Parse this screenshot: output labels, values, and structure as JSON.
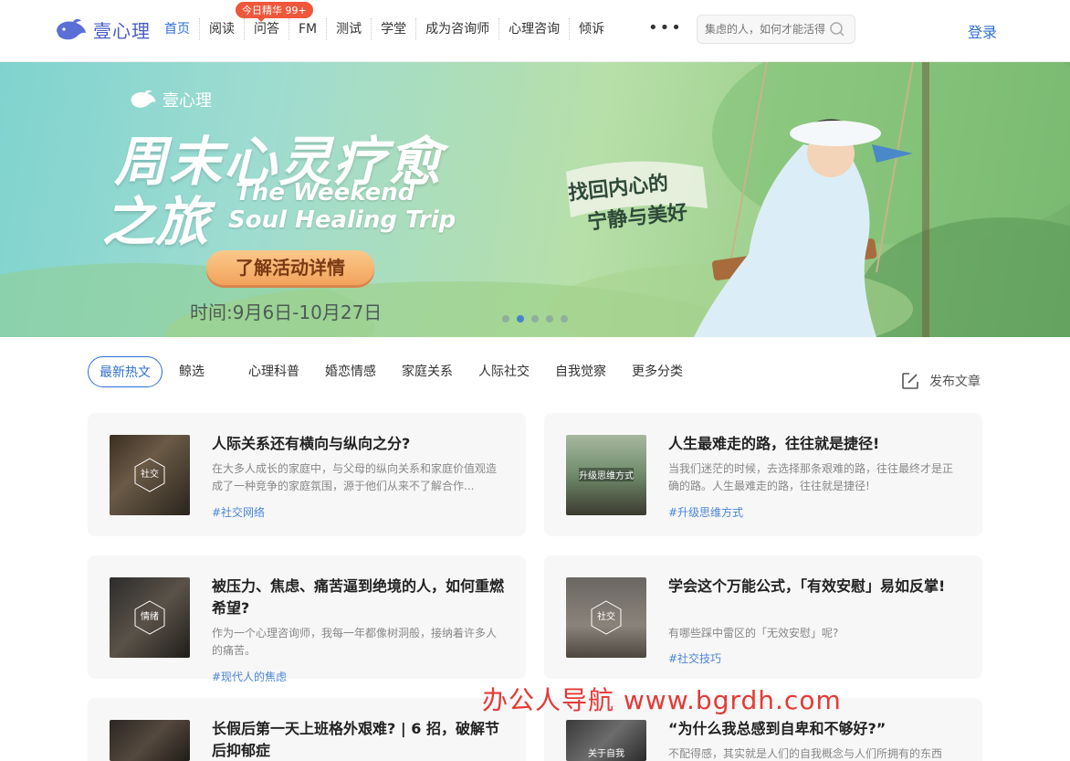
{
  "header": {
    "logo_text": "壹心理",
    "nav": [
      "首页",
      "阅读",
      "问答",
      "FM",
      "测试",
      "学堂",
      "成为咨询师",
      "心理咨询",
      "倾诉"
    ],
    "hot_badge": "今日精华 99+",
    "more": "•••",
    "search_placeholder": "集虑的人，如何才能活得",
    "login": "登录",
    "accent_color": "#2f6fd6"
  },
  "banner": {
    "brand": "壹心理",
    "title_line1": "周末心灵疗愈",
    "title_line2": "之旅",
    "subtitle_en1": "The Weekend",
    "subtitle_en2": "Soul Healing Trip",
    "cta": "了解活动详情",
    "date": "时间:9月6日-10月27日",
    "slogan1": "找回内心的",
    "slogan2": "宁静与美好",
    "slide_count": 5,
    "active_slide": 2
  },
  "categories": {
    "items": [
      "最新热文",
      "鲸选",
      "心理科普",
      "婚恋情感",
      "家庭关系",
      "人际社交",
      "自我觉察",
      "更多分类"
    ],
    "publish": "发布文章"
  },
  "articles": [
    {
      "title": "人际关系还有横向与纵向之分?",
      "desc": "在大多人成长的家庭中，与父母的纵向关系和家庭价值观造成了一种竞争的家庭氛围，源于他们从来不了解合作...",
      "tag": "#社交网络",
      "thumb_label": "社交"
    },
    {
      "title": "人生最难走的路，往往就是捷径!",
      "desc": "当我们迷茫的时候，去选择那条艰难的路，往往最终才是正确的路。人生最难走的路，往往就是捷径!",
      "tag": "#升级思维方式",
      "thumb_label": "升级思维方式"
    },
    {
      "title": "被压力、焦虑、痛苦逼到绝境的人，如何重燃希望?",
      "desc": "作为一个心理咨询师，我每一年都像树洞般，接纳着许多人的痛苦。",
      "tag": "#现代人的焦虑",
      "thumb_label": "情绪"
    },
    {
      "title": "学会这个万能公式，「有效安慰」易如反掌!",
      "desc": "有哪些踩中雷区的「无效安慰」呢?",
      "tag": "#社交技巧",
      "thumb_label": "社交"
    },
    {
      "title": "长假后第一天上班格外艰难? | 6 招，破解节后抑郁症",
      "desc": "",
      "tag": "",
      "thumb_label": ""
    },
    {
      "title": "“为什么我总感到自卑和不够好?”",
      "desc": "不配得感，其实就是人们的自我概念与人们所拥有的东西",
      "tag": "",
      "thumb_label": "关于自我"
    }
  ],
  "watermark": "办公人导航   www.bgrdh.com"
}
